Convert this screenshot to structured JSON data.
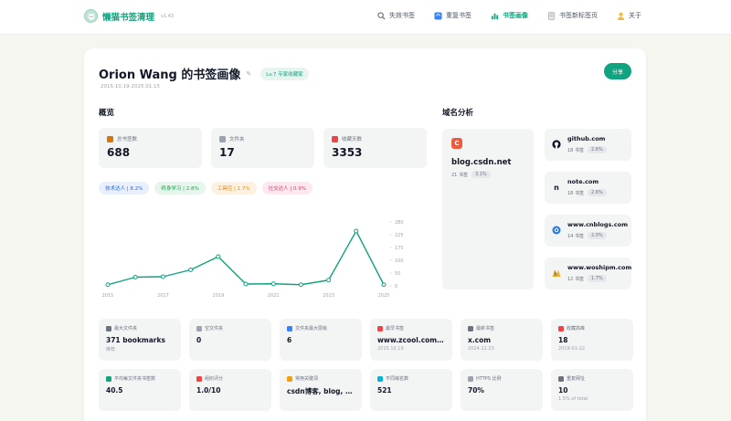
{
  "app": {
    "name": "懒猫书签清理",
    "version": "v1.43"
  },
  "nav": [
    {
      "label": "失效书签",
      "icon": "search-icon"
    },
    {
      "label": "重复书签",
      "icon": "duplicate-icon"
    },
    {
      "label": "书签画像",
      "icon": "bar-chart-icon"
    },
    {
      "label": "书签新标签页",
      "icon": "document-icon"
    },
    {
      "label": "关于",
      "icon": "person-icon"
    }
  ],
  "profile": {
    "title": "Orion Wang 的书签画像",
    "level": "Lv.7  专家收藏家",
    "date_range": "2015.10.19-2025.01.15",
    "share_label": "分享"
  },
  "overview": {
    "title": "概览",
    "stats": [
      {
        "label": "总书签数",
        "value": "688",
        "icon": "bookmark-icon"
      },
      {
        "label": "文件夹",
        "value": "17",
        "icon": "folder-icon"
      },
      {
        "label": "收藏天数",
        "value": "3353",
        "icon": "calendar-icon"
      }
    ],
    "tags": [
      {
        "label": "技术达人",
        "pct": "8.2%",
        "color": "#2563eb",
        "bg": "#e8f0fe"
      },
      {
        "label": "终身学习",
        "pct": "2.8%",
        "color": "#16a34a",
        "bg": "#e6f6ec"
      },
      {
        "label": "工具控",
        "pct": "1.7%",
        "color": "#ea8a0c",
        "bg": "#fdf1e1"
      },
      {
        "label": "社交达人",
        "pct": "0.9%",
        "color": "#db3a6a",
        "bg": "#fce8ee"
      }
    ]
  },
  "chart_data": {
    "type": "line",
    "x": [
      2015,
      2016,
      2017,
      2018,
      2019,
      2020,
      2021,
      2022,
      2023,
      2024,
      2025
    ],
    "values": [
      5,
      38,
      40,
      70,
      128,
      8,
      9,
      5,
      25,
      240,
      5
    ],
    "xticks": [
      "2015",
      "2017",
      "2019",
      "2021",
      "2023",
      "2025"
    ],
    "yticks": [
      "0",
      "50",
      "100",
      "175",
      "225",
      "280"
    ],
    "ylim": [
      0,
      280
    ],
    "color": "#10a37f"
  },
  "domains": {
    "title": "域名分析",
    "top": {
      "name": "blog.csdn.net",
      "count": "21 书签",
      "pct": "3.1%",
      "icon_letter": "C"
    },
    "list": [
      {
        "name": "github.com",
        "count": "18 书签",
        "pct": "2.6%",
        "icon": "github-icon"
      },
      {
        "name": "note.com",
        "count": "18 书签",
        "pct": "2.6%",
        "icon": "note-icon"
      },
      {
        "name": "www.cnblogs.com",
        "count": "14 书签",
        "pct": "2.0%",
        "icon": "cnblogs-icon"
      },
      {
        "name": "www.woshipm.com",
        "count": "12 书签",
        "pct": "1.7%",
        "icon": "woshipm-icon"
      }
    ]
  },
  "details": [
    {
      "label": "最大文件夹",
      "value": "371 bookmarks",
      "sub": "推荐",
      "icon_color": "#6b7280"
    },
    {
      "label": "空文件夹",
      "value": "0",
      "sub": "",
      "icon_color": "#9ca3af"
    },
    {
      "label": "文件夹最大层级",
      "value": "6",
      "sub": "",
      "icon_color": "#3b82f6"
    },
    {
      "label": "最早书签",
      "value": "www.zcool.com.cn",
      "sub": "2015.10.19",
      "icon_color": "#ef4444"
    },
    {
      "label": "最新书签",
      "value": "x.com",
      "sub": "2024.12.23",
      "icon_color": "#6b7280"
    },
    {
      "label": "收藏高峰",
      "value": "18",
      "sub": "2019-01-22",
      "icon_color": "#ef4444"
    },
    {
      "label": "平均每文件夹书签数",
      "value": "40.5",
      "sub": "",
      "icon_color": "#10a37f"
    },
    {
      "label": "组织评分",
      "value": "1.0/10",
      "sub": "",
      "icon_color": "#ef4444"
    },
    {
      "label": "常用关键词",
      "value": "csdn博客, blog, 人...",
      "sub": "",
      "icon_color": "#f59e0b"
    },
    {
      "label": "不同域名数",
      "value": "521",
      "sub": "",
      "icon_color": "#06b6d4"
    },
    {
      "label": "HTTPS 比例",
      "value": "70%",
      "sub": "",
      "icon_color": "#9ca3af"
    },
    {
      "label": "重复网址",
      "value": "10",
      "sub": "1.5% of total",
      "icon_color": "#6b7280"
    }
  ]
}
